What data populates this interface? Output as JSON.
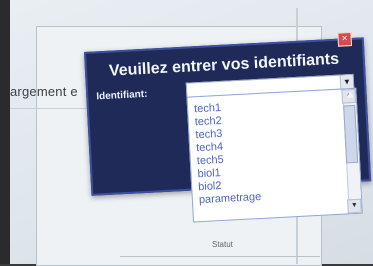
{
  "background": {
    "partial_text": "argement e",
    "status_label": "Statut"
  },
  "dialog": {
    "title": "Veuillez entrer vos identifiants",
    "identifiant_label": "Identifiant:",
    "identifiant_value": "",
    "close_label": "×"
  },
  "dropdown": {
    "options": [
      "tech1",
      "tech2",
      "tech3",
      "tech4",
      "tech5",
      "biol1",
      "biol2",
      "parametrage"
    ]
  }
}
